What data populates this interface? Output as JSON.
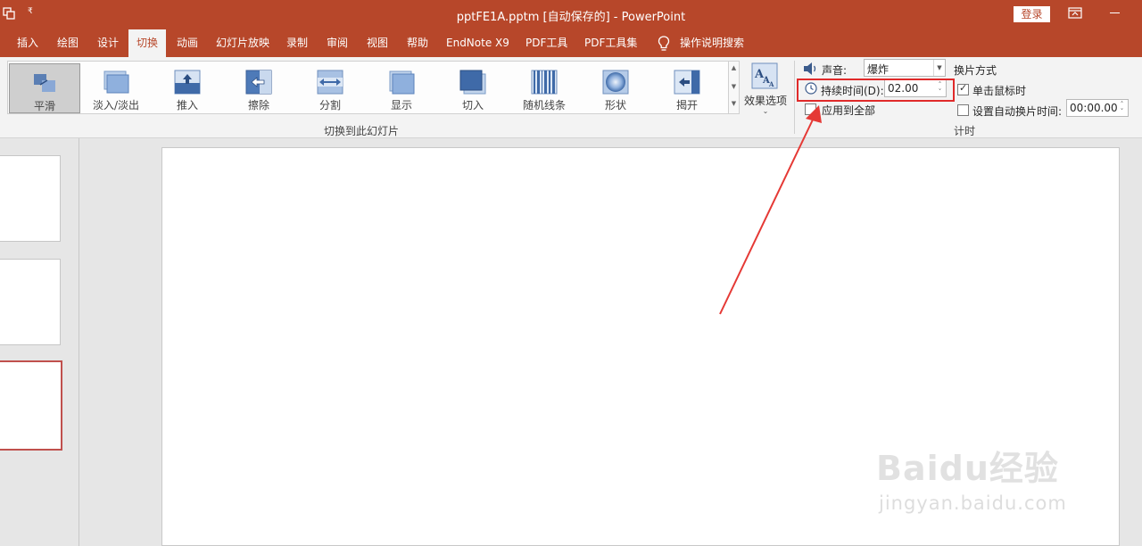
{
  "titlebar": {
    "title": "pptFE1A.pptm [自动保存的] - PowerPoint",
    "signin_label": "登录",
    "qat_arrow": "₹"
  },
  "tabs": [
    "插入",
    "绘图",
    "设计",
    "切换",
    "动画",
    "幻灯片放映",
    "录制",
    "审阅",
    "视图",
    "帮助",
    "EndNote X9",
    "PDF工具",
    "PDF工具集"
  ],
  "active_tab": "切换",
  "tell_me": "操作说明搜索",
  "transitions": {
    "items": [
      "平滑",
      "淡入/淡出",
      "推入",
      "擦除",
      "分割",
      "显示",
      "切入",
      "随机线条",
      "形状",
      "揭开"
    ],
    "selected": "平滑",
    "effect_options_label": "效果选项",
    "effect_chevron": "⌄",
    "group_label": "切换到此幻灯片"
  },
  "timing": {
    "sound_label": "声音:",
    "sound_value": "爆炸",
    "duration_label": "持续时间(D):",
    "duration_value": "02.00",
    "apply_all_label": "应用到全部",
    "apply_all_checked": false,
    "advance_header": "换片方式",
    "on_click_label": "单击鼠标时",
    "on_click_checked": true,
    "after_label": "设置自动换片时间:",
    "after_checked": false,
    "after_value": "00:00.00",
    "group_label": "计时"
  },
  "watermark": {
    "logo": "Baidu经验",
    "url": "jingyan.baidu.com"
  },
  "colors": {
    "accent": "#b7472a",
    "annotation": "#e02a2a"
  }
}
